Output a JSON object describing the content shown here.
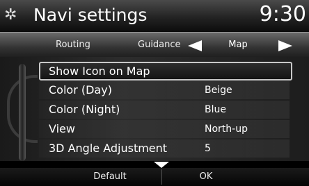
{
  "header": {
    "title": "Navi settings",
    "clock": "9:30",
    "icon": "gear-icon"
  },
  "tabs": {
    "items": [
      {
        "label": "Routing"
      },
      {
        "label": "Guidance"
      },
      {
        "label": "Map",
        "selected": true
      }
    ],
    "prev_icon": "arrow-left-icon",
    "next_icon": "arrow-right-icon"
  },
  "settings": [
    {
      "label": "Show Icon on Map",
      "value": ""
    },
    {
      "label": "Color (Day)",
      "value": "Beige"
    },
    {
      "label": "Color (Night)",
      "value": "Blue"
    },
    {
      "label": "View",
      "value": "North-up"
    },
    {
      "label": "3D Angle Adjustment",
      "value": "5"
    }
  ],
  "footer": {
    "default_label": "Default",
    "ok_label": "OK",
    "more_icon": "chevron-down-icon"
  }
}
